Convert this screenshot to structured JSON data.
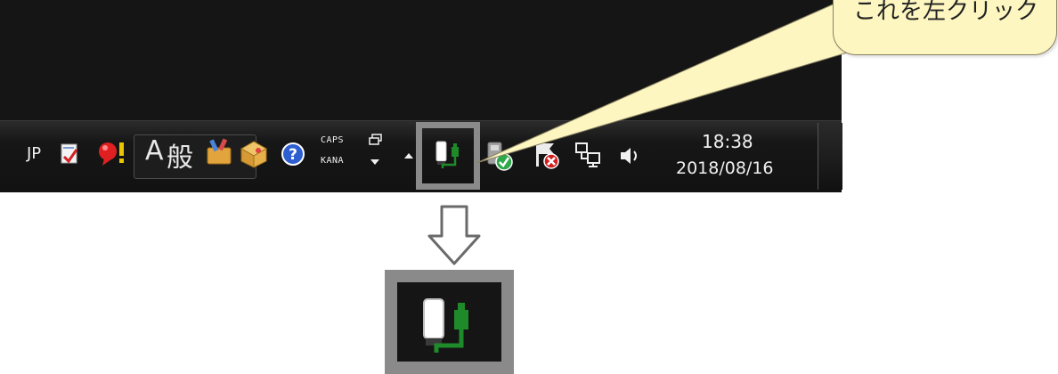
{
  "callout": {
    "text": "これを左クリック"
  },
  "taskbar": {
    "language": "JP",
    "ime_mode_alpha": "A",
    "ime_mode_kanji": "般",
    "caps_indicator": "CAPS",
    "kana_indicator": "KANA",
    "clock": {
      "time": "18:38",
      "date": "2018/08/16"
    },
    "icons": [
      "ime-pad-icon",
      "ime-alert-icon",
      "ime-tools-icon",
      "ime-dictionary-icon",
      "help-icon",
      "ime-options-icon",
      "show-hidden-icons-arrow",
      "usb-device-icon",
      "update-shield-icon",
      "action-center-flag-icon",
      "network-icon",
      "volume-icon"
    ]
  },
  "colors": {
    "taskbar": "#151515",
    "highlight": "#8a8a8a",
    "callout_fill": "#fdf6c0",
    "device_white": "#ffffff",
    "device_green": "#1e8a2a"
  }
}
